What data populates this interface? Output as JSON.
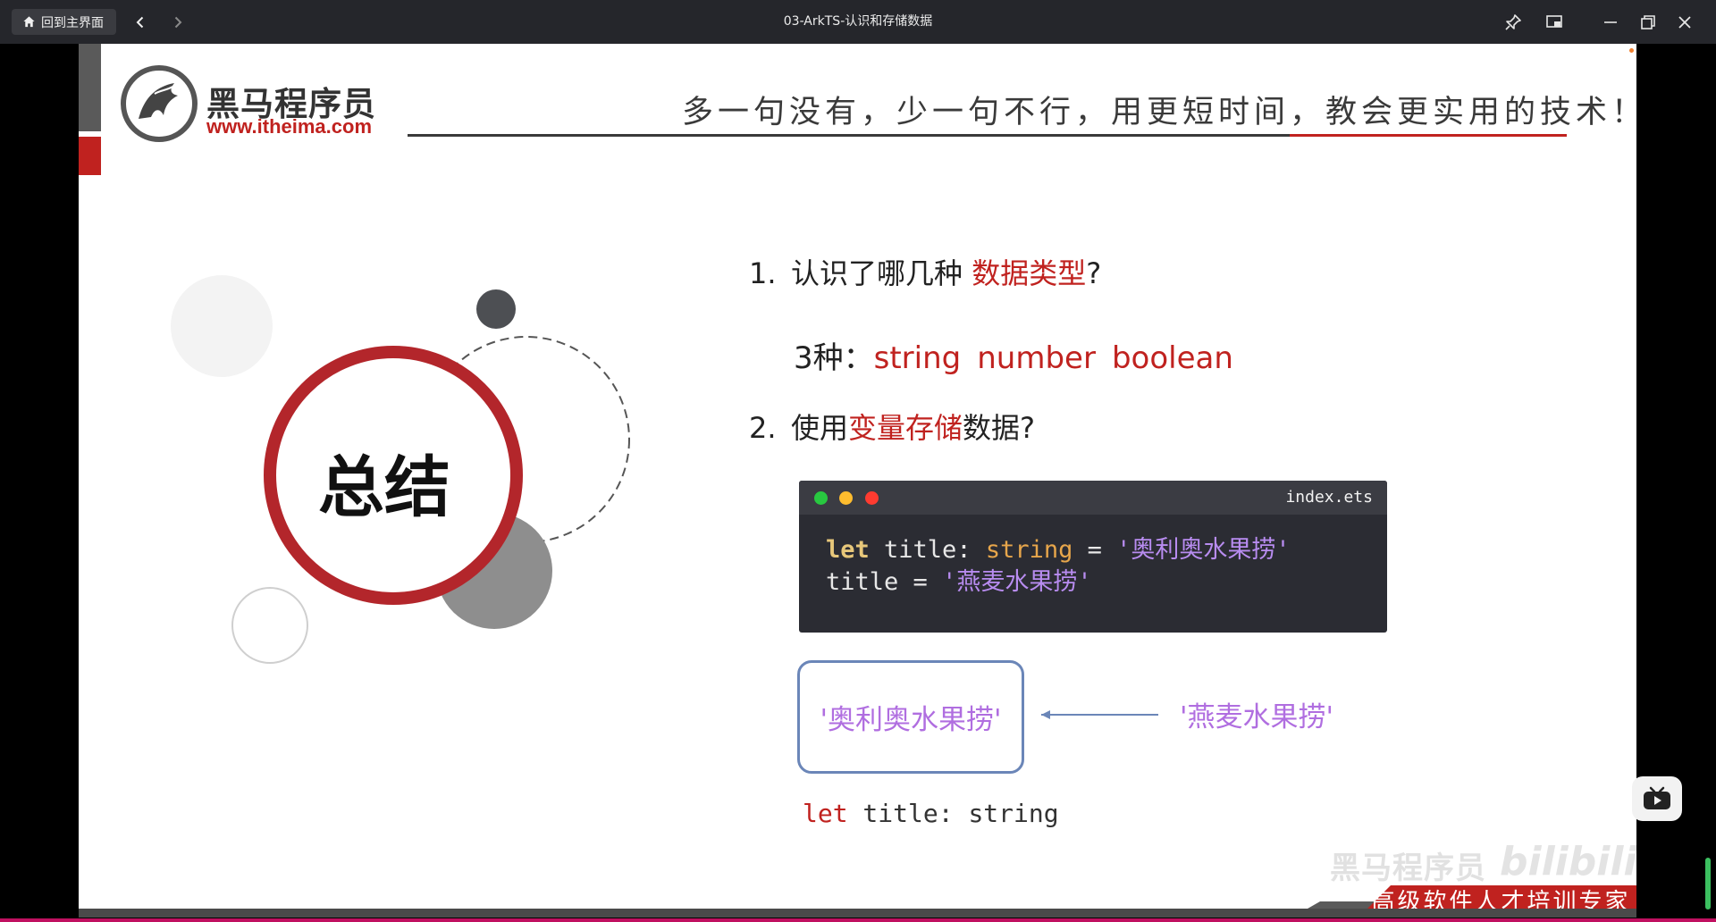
{
  "titlebar": {
    "home_label": "回到主界面",
    "window_title": "03-ArkTS-认识和存储数据",
    "icons": [
      "home-icon",
      "back-arrow-icon",
      "forward-arrow-icon",
      "pin-icon",
      "picture-in-picture-icon",
      "minimize-icon",
      "restore-icon",
      "close-icon"
    ]
  },
  "slide": {
    "logo": {
      "cn": "黑马程序员",
      "url": "www.itheima.com"
    },
    "slogan": "多一句没有，少一句不行，用更短时间，教会更实用的技术！",
    "summary_title": "总结",
    "q1": {
      "num": "1.",
      "text_before": "认识了哪几种 ",
      "highlight": "数据类型",
      "text_after": "?"
    },
    "answer": {
      "prefix": "3种：",
      "types": [
        "string",
        "number",
        "boolean"
      ]
    },
    "q2": {
      "num": "2.",
      "text_before": "使用",
      "highlight": "变量存储",
      "text_after": "数据?"
    },
    "code": {
      "filename": "index.ets",
      "line1": {
        "kw": "let",
        "name": " title:",
        "type": " string",
        "op": " = ",
        "str": "'奥利奥水果捞'"
      },
      "line2": {
        "name": "title",
        "op": " = ",
        "str": "'燕麦水果捞'"
      },
      "dot_colors": [
        "#28c840",
        "#febc2e",
        "#ff3b30"
      ]
    },
    "box_value": "'奥利奥水果捞'",
    "new_value": "'燕麦水果捞'",
    "declaration": {
      "kw": "let",
      "rest": " title: string"
    },
    "footer": "高级软件人才培训专家",
    "watermark": "黑马程序员",
    "watermark_bili": "bilibili"
  },
  "colors": {
    "accent_red": "#c0221f",
    "string_purple": "#b06ee0",
    "titlebar_bg": "#25262b"
  }
}
